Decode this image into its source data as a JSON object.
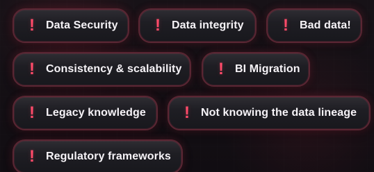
{
  "tags": [
    {
      "label": "Data Security",
      "icon": "!"
    },
    {
      "label": "Data integrity",
      "icon": "!"
    },
    {
      "label": "Bad data!",
      "icon": "!"
    },
    {
      "label": "Consistency & scalability",
      "icon": "!"
    },
    {
      "label": "BI Migration",
      "icon": "!"
    },
    {
      "label": "Legacy knowledge",
      "icon": "!"
    },
    {
      "label": "Not knowing the data lineage",
      "icon": "!"
    },
    {
      "label": "Regulatory frameworks",
      "icon": "!"
    }
  ],
  "colors": {
    "background": "#140f14",
    "pill_border": "#5a2633",
    "accent": "#ff4a69",
    "text": "#f6f3f7"
  }
}
